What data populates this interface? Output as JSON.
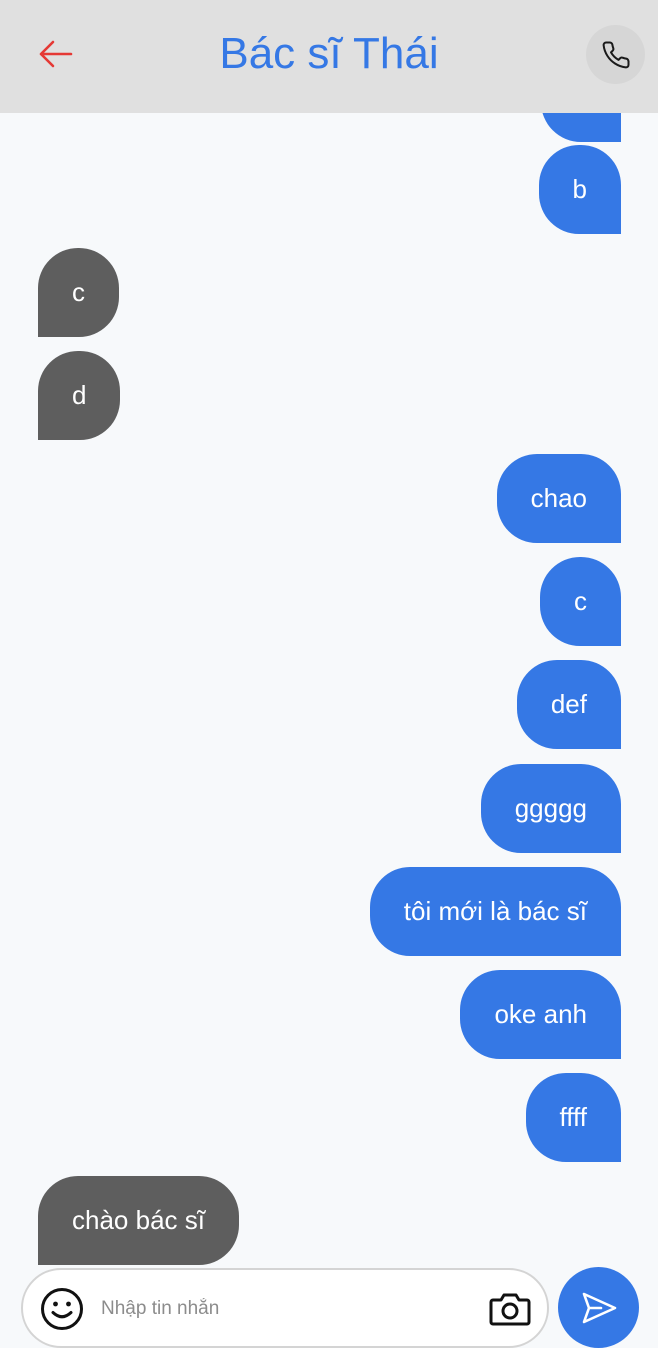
{
  "header": {
    "title": "Bác sĩ Thái",
    "back_icon": "arrow-left-icon",
    "call_icon": "phone-icon"
  },
  "messages": [
    {
      "from": "me",
      "text": "b"
    },
    {
      "from": "other",
      "text": "c"
    },
    {
      "from": "other",
      "text": "d"
    },
    {
      "from": "me",
      "text": "chao"
    },
    {
      "from": "me",
      "text": "c"
    },
    {
      "from": "me",
      "text": "def"
    },
    {
      "from": "me",
      "text": "ggggg"
    },
    {
      "from": "me",
      "text": "tôi mới là bác sĩ"
    },
    {
      "from": "me",
      "text": "oke anh"
    },
    {
      "from": "me",
      "text": "ffff"
    },
    {
      "from": "other",
      "text": "chào bác sĩ"
    }
  ],
  "composer": {
    "placeholder": "Nhập tin nhắn",
    "value": "",
    "emoji_icon": "smile-icon",
    "camera_icon": "camera-icon",
    "send_icon": "send-icon"
  },
  "colors": {
    "accent": "#3578e5",
    "received_bubble": "#5e5e5e",
    "back_arrow": "#e53935",
    "header_bg": "#e0e0e0"
  }
}
